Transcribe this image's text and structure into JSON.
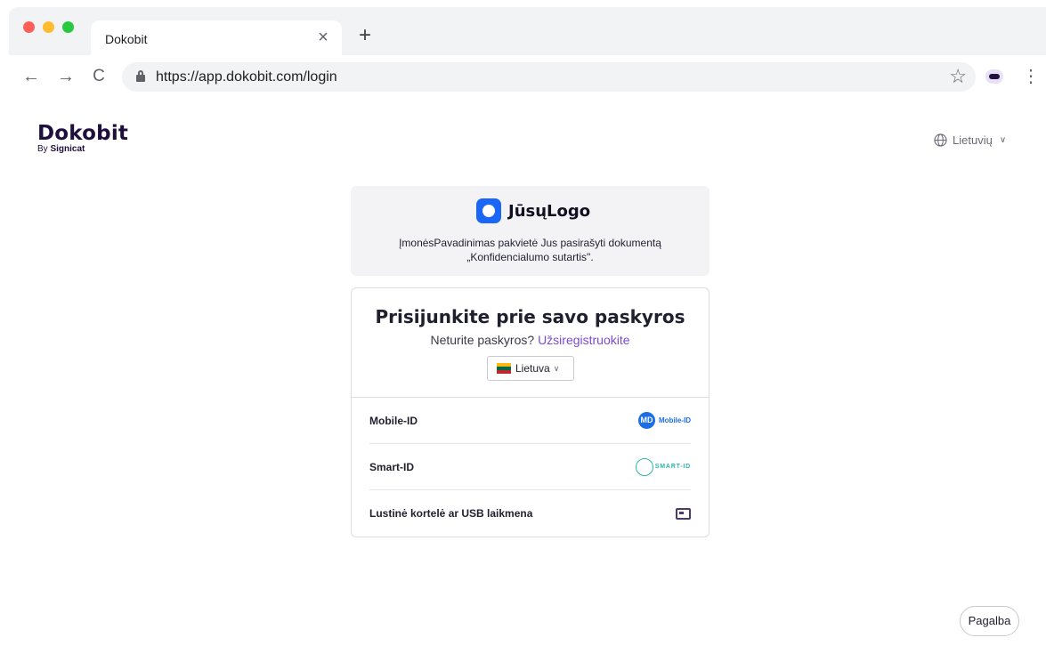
{
  "browser": {
    "tab_title": "Dokobit",
    "tab_close": "×",
    "new_tab": "+",
    "url": "https://app.dokobit.com/login",
    "back": "←",
    "forward": "→",
    "reload": "C",
    "star": "☆",
    "menu": "⋮"
  },
  "header": {
    "logo_main": "Dokobit",
    "logo_by": "By",
    "logo_vendor": "Signicat",
    "language": "Lietuvių",
    "language_chevron": "∨"
  },
  "invite": {
    "brand_name": "JūsųLogo",
    "text": "ĮmonėsPavadinimas pakvietė Jus pasirašyti dokumentą „Konfidencialumo sutartis\"."
  },
  "login": {
    "title": "Prisijunkite prie savo paskyros",
    "no_account": "Neturite paskyros?",
    "register_link": "Užsiregistruokite",
    "country": "Lietuva",
    "country_chevron": "∨",
    "flag_colors": [
      "#fdb913",
      "#006a44",
      "#c1272d"
    ],
    "methods": [
      {
        "label": "Mobile-ID",
        "logo_text": "Mobile-ID",
        "logo_mark": "MD",
        "icon": "mobile-id-logo"
      },
      {
        "label": "Smart-ID",
        "logo_text": "SMART-ID",
        "icon": "smart-id-logo"
      },
      {
        "label": "Lustinė kortelė ar USB laikmena",
        "icon": "smart-card-icon"
      }
    ]
  },
  "help_button": "Pagalba",
  "colors": {
    "accent": "#7a4bd6",
    "brand_dark": "#1e0f3c",
    "brand_blue": "#1a66f5",
    "mobile_id_blue": "#1b6ee6",
    "smart_id_teal": "#2bb5a8"
  }
}
